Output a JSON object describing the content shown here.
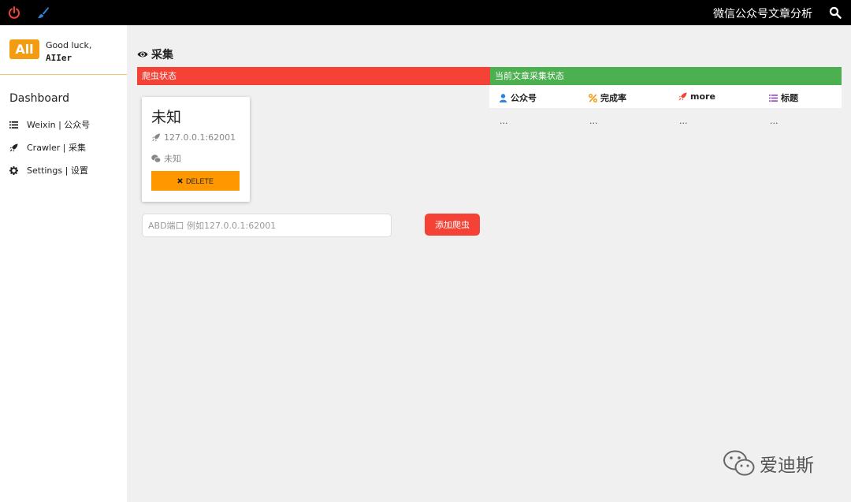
{
  "topbar": {
    "power_icon": "power-icon",
    "brush_icon": "brush-icon",
    "title": "微信公众号文章分析",
    "search_icon": "search-icon"
  },
  "sidebar": {
    "avatar": "All",
    "greeting": "Good luck,",
    "username": "AIIer",
    "heading": "Dashboard",
    "items": [
      {
        "label": "Weixin | 公众号",
        "icon": "list-icon"
      },
      {
        "label": "Crawler | 采集",
        "icon": "rocket-icon"
      },
      {
        "label": "Settings | 设置",
        "icon": "gear-icon"
      }
    ]
  },
  "main": {
    "title": "采集",
    "crawler_status_label": "爬虫状态",
    "article_status_label": "当前文章采集状态",
    "card": {
      "title": "未知",
      "address": "127.0.0.1:62001",
      "status": "未知",
      "delete_label": "DELETE"
    },
    "adb_input": {
      "placeholder": "ABD端口 例如127.0.0.1:62001",
      "value": ""
    },
    "add_button": "添加爬虫",
    "table": {
      "headers": [
        {
          "label": "公众号",
          "icon": "user-icon",
          "color": "#2e86de"
        },
        {
          "label": "完成率",
          "icon": "percent-icon",
          "color": "#f39c12"
        },
        {
          "label": "more",
          "icon": "rocket-icon",
          "color": "#f44336"
        },
        {
          "label": "标题",
          "icon": "list-icon",
          "color": "#9b59b6"
        }
      ],
      "row": [
        "...",
        "...",
        "...",
        "..."
      ]
    }
  },
  "watermark": "爱迪斯",
  "colors": {
    "accent_red": "#f44336",
    "accent_green": "#4caf50",
    "accent_orange": "#ff9800"
  }
}
